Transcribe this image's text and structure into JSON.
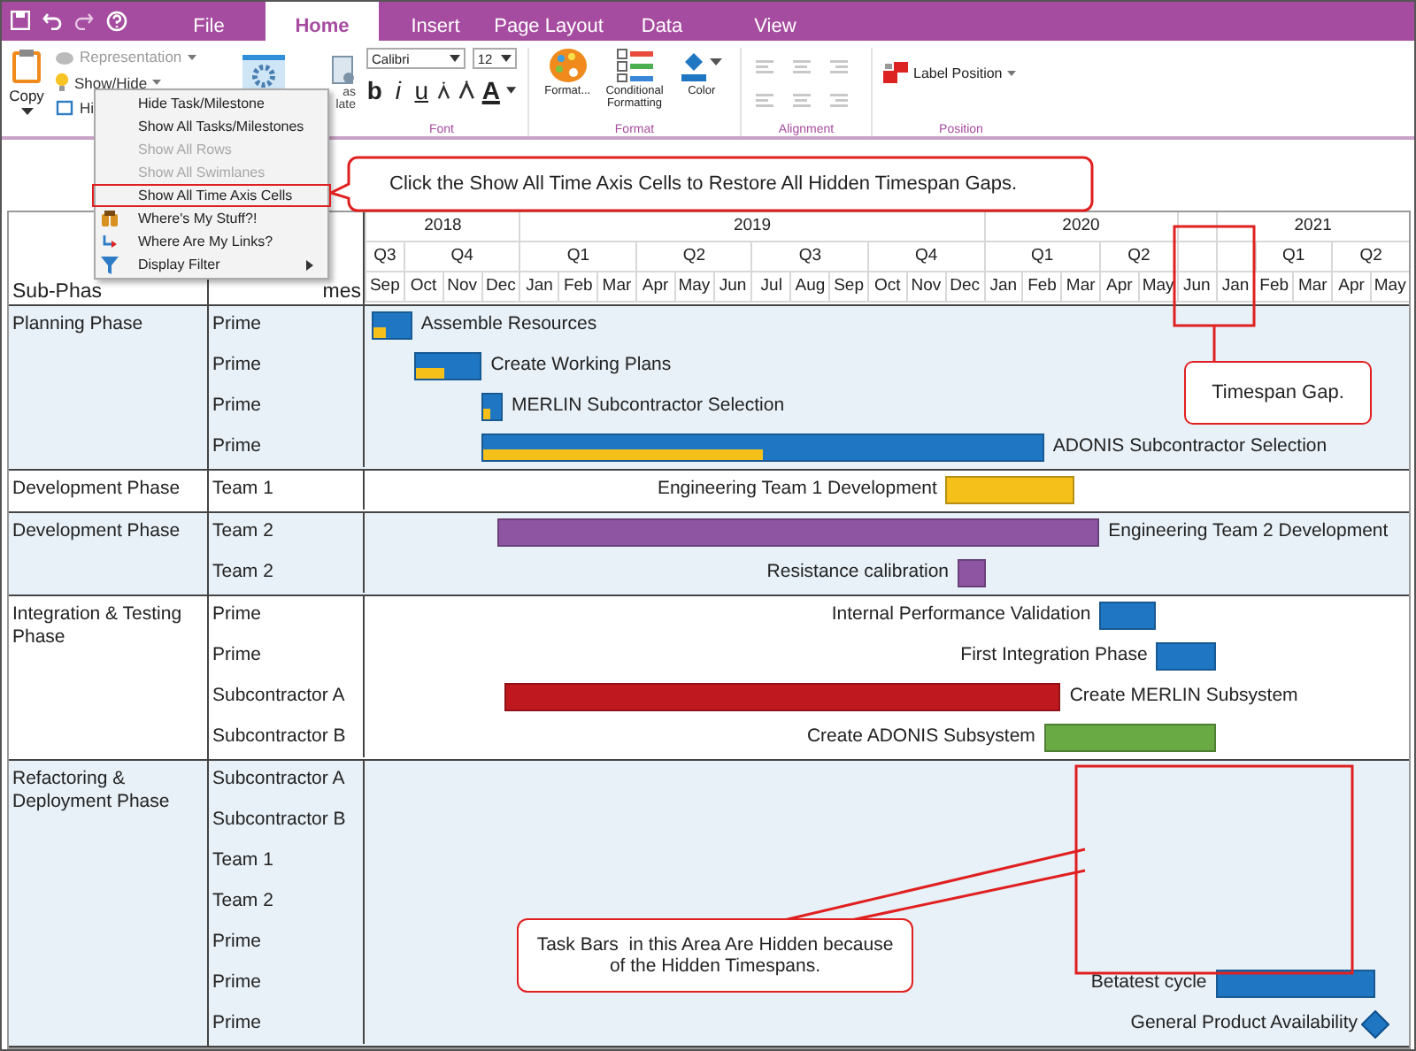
{
  "tabs": [
    {
      "label": "File",
      "selected": false
    },
    {
      "label": "Home",
      "selected": true
    },
    {
      "label": "Insert",
      "selected": false
    },
    {
      "label": "Page Layout",
      "selected": false
    },
    {
      "label": "Data",
      "selected": false
    },
    {
      "label": "View",
      "selected": false
    }
  ],
  "ribbon": {
    "copy": "Copy",
    "view_buttons": [
      {
        "label": "Representation",
        "kind": "representation",
        "disabled": true
      },
      {
        "label": "Show/Hide",
        "kind": "showhide",
        "disabled": false
      },
      {
        "label": "Hi",
        "kind": "hide",
        "disabled": false
      }
    ],
    "template_lines": [
      "as",
      "late"
    ],
    "font": {
      "family": "Calibri",
      "size": "12",
      "styles": [
        {
          "glyph": "b",
          "kind": "bold"
        },
        {
          "glyph": "i",
          "kind": "italic"
        },
        {
          "glyph": "u",
          "kind": "underline"
        }
      ],
      "color_glyph": "A",
      "group_label": "Font"
    },
    "format": {
      "buttons": [
        {
          "label": "Format...",
          "kind": "palette"
        },
        {
          "label": "Conditional Formatting",
          "kind": "conditional"
        },
        {
          "label": "Color",
          "kind": "color"
        }
      ],
      "group_label": "Format"
    },
    "alignment": {
      "group_label": "Alignment"
    },
    "position": {
      "button": "Label Position",
      "group_label": "Position"
    }
  },
  "menu": {
    "items": [
      {
        "label": "Hide Task/Milestone",
        "kind": "plain",
        "disabled": false,
        "highlighted": false
      },
      {
        "label": "Show All Tasks/Milestones",
        "kind": "plain",
        "disabled": false,
        "highlighted": false
      },
      {
        "label": "Show All Rows",
        "kind": "plain",
        "disabled": true,
        "highlighted": false
      },
      {
        "label": "Show All Swimlanes",
        "kind": "plain",
        "disabled": true,
        "highlighted": false
      },
      {
        "label": "Show All Time Axis Cells",
        "kind": "plain",
        "disabled": false,
        "highlighted": true
      },
      {
        "label": "Where's My Stuff?!",
        "kind": "find",
        "disabled": false,
        "highlighted": false
      },
      {
        "label": "Where Are My Links?",
        "kind": "links",
        "disabled": false,
        "highlighted": false
      },
      {
        "label": "Display Filter",
        "kind": "filter",
        "disabled": false,
        "highlighted": false
      }
    ]
  },
  "callouts": [
    {
      "kind": "menu",
      "text": "Click the Show All Time Axis Cells to Restore All Hidden Timespan Gaps."
    },
    {
      "kind": "gap",
      "text": "Timespan Gap."
    },
    {
      "kind": "area",
      "text": "Task Bars  in this Area Are Hidden because of the Hidden Timespans."
    }
  ],
  "gantt": {
    "header": {
      "phase": "Sub-Phas",
      "team": "mes"
    },
    "years": [
      {
        "label": "2018",
        "quarters": [
          {
            "label": "Q3",
            "months": [
              "Sep"
            ]
          },
          {
            "label": "Q4",
            "months": [
              "Oct",
              "Nov",
              "Dec"
            ]
          }
        ]
      },
      {
        "label": "2019",
        "quarters": [
          {
            "label": "Q1",
            "months": [
              "Jan",
              "Feb",
              "Mar"
            ]
          },
          {
            "label": "Q2",
            "months": [
              "Apr",
              "May",
              "Jun"
            ]
          },
          {
            "label": "Q3",
            "months": [
              "Jul",
              "Aug",
              "Sep"
            ]
          },
          {
            "label": "Q4",
            "months": [
              "Oct",
              "Nov",
              "Dec"
            ]
          }
        ]
      },
      {
        "label": "2020",
        "quarters": [
          {
            "label": "Q1",
            "months": [
              "Jan",
              "Feb",
              "Mar"
            ]
          },
          {
            "label": "Q2",
            "months": [
              "Apr",
              "May"
            ]
          }
        ]
      },
      {
        "quarters": [
          {
            "months": [
              "Jun"
            ]
          }
        ]
      },
      {
        "label": "2021",
        "quarters": [
          {
            "months": [
              "Jan"
            ]
          },
          {
            "label": "Q1",
            "months": [
              "Feb",
              "Mar"
            ]
          },
          {
            "label": "Q2",
            "months": [
              "Apr",
              "May"
            ]
          }
        ]
      }
    ],
    "lanes": [
      {
        "phase": "Planning Phase",
        "shaded": true,
        "rows": [
          {
            "team": "Prime",
            "bar": {
              "kind": "task",
              "label": "Assemble Resources",
              "color": "#1f77c4",
              "level": 0.35
            }
          },
          {
            "team": "Prime",
            "bar": {
              "kind": "task",
              "label": "Create Working Plans",
              "color": "#1f77c4",
              "level": 0.45
            }
          },
          {
            "team": "Prime",
            "bar": {
              "kind": "task",
              "label": "MERLIN Subcontractor Selection",
              "color": "#1f77c4",
              "level": 0.4
            }
          },
          {
            "team": "Prime",
            "bar": {
              "kind": "task",
              "label": "ADONIS Subcontractor Selection",
              "color": "#1f77c4",
              "level": 0.5
            }
          }
        ]
      },
      {
        "phase": "Development Phase",
        "shaded": false,
        "rows": [
          {
            "team": "Team 1",
            "bar": {
              "kind": "task",
              "label": "Engineering Team 1 Development",
              "color": "#f5c01a"
            }
          }
        ]
      },
      {
        "phase": "Development Phase",
        "shaded": true,
        "rows": [
          {
            "team": "Team 2",
            "bar": {
              "kind": "task",
              "label": "Engineering Team 2 Development",
              "color": "#8e56a2"
            }
          },
          {
            "team": "Team 2",
            "bar": {
              "kind": "task",
              "label": "Resistance calibration",
              "color": "#8e56a2"
            }
          }
        ]
      },
      {
        "phase": "Integration & Testing Phase",
        "shaded": false,
        "rows": [
          {
            "team": "Prime",
            "bar": {
              "kind": "task",
              "label": "Internal Performance Validation",
              "color": "#1f77c4"
            }
          },
          {
            "team": "Prime",
            "bar": {
              "kind": "task",
              "label": "First Integration Phase",
              "color": "#1f77c4"
            }
          },
          {
            "team": "Subcontractor A",
            "bar": {
              "kind": "task",
              "label": "Create MERLIN Subsystem",
              "color": "#c0181f"
            }
          },
          {
            "team": "Subcontractor B",
            "bar": {
              "kind": "task",
              "label": "Create ADONIS Subsystem",
              "color": "#6aaa45"
            }
          }
        ]
      },
      {
        "phase": "Refactoring & Deployment Phase",
        "shaded": true,
        "rows": [
          {
            "team": "Subcontractor A"
          },
          {
            "team": "Subcontractor B"
          },
          {
            "team": "Team 1"
          },
          {
            "team": "Team 2"
          },
          {
            "team": "Prime"
          },
          {
            "team": "Prime",
            "bar": {
              "kind": "task",
              "label": "Betatest cycle",
              "color": "#1f77c4"
            }
          },
          {
            "team": "Prime",
            "bar": {
              "kind": "milestone",
              "label": "General Product Availability",
              "color": "#1f77c4"
            }
          }
        ]
      }
    ]
  }
}
